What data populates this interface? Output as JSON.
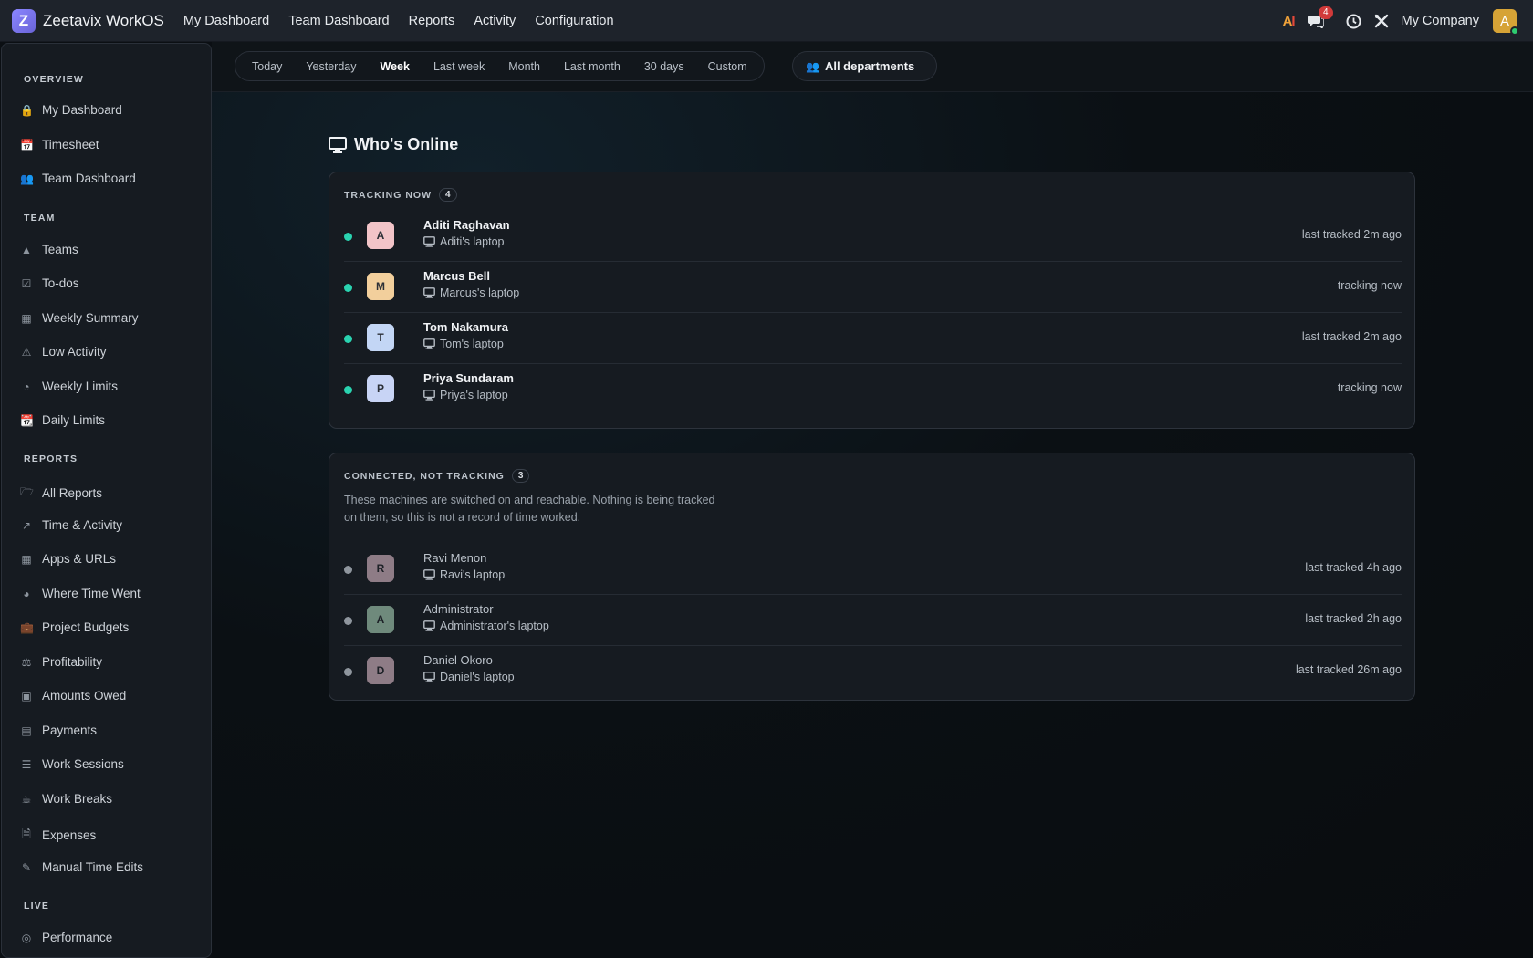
{
  "app": {
    "brand": "Zeetavix WorkOS",
    "brand_letter": "Z",
    "nav": [
      "My Dashboard",
      "Team Dashboard",
      "Reports",
      "Activity",
      "Configuration"
    ],
    "ai_label": "AI",
    "messages_badge": "4",
    "company": "My Company",
    "avatar_letter": "A"
  },
  "sidebar": {
    "overview_label": "OVERVIEW",
    "team_label": "TEAM",
    "reports_label": "REPORTS",
    "live_label": "LIVE",
    "overview": [
      {
        "label": "My Dashboard",
        "icon": "lock-icon"
      },
      {
        "label": "Timesheet",
        "icon": "calendar-icon"
      },
      {
        "label": "Team Dashboard",
        "icon": "users-icon"
      }
    ],
    "team": [
      {
        "label": "Teams",
        "icon": "sitemap-icon"
      },
      {
        "label": "To-dos",
        "icon": "check-square-icon"
      },
      {
        "label": "Weekly Summary",
        "icon": "table-icon"
      },
      {
        "label": "Low Activity",
        "icon": "warning-icon"
      },
      {
        "label": "Weekly Limits",
        "icon": "gauge-icon"
      },
      {
        "label": "Daily Limits",
        "icon": "calendar-check-icon"
      }
    ],
    "reports": [
      {
        "label": "All Reports",
        "icon": "folder-icon"
      },
      {
        "label": "Time & Activity",
        "icon": "line-chart-icon"
      },
      {
        "label": "Apps & URLs",
        "icon": "grid-icon"
      },
      {
        "label": "Where Time Went",
        "icon": "pie-chart-icon"
      },
      {
        "label": "Project Budgets",
        "icon": "briefcase-icon"
      },
      {
        "label": "Profitability",
        "icon": "scale-icon"
      },
      {
        "label": "Amounts Owed",
        "icon": "money-icon"
      },
      {
        "label": "Payments",
        "icon": "credit-card-icon"
      },
      {
        "label": "Work Sessions",
        "icon": "list-icon"
      },
      {
        "label": "Work Breaks",
        "icon": "coffee-icon"
      },
      {
        "label": "Expenses",
        "icon": "receipt-icon"
      },
      {
        "label": "Manual Time Edits",
        "icon": "edit-icon"
      }
    ],
    "live": [
      {
        "label": "Performance",
        "icon": "target-icon"
      }
    ]
  },
  "filters": {
    "periods": [
      "Today",
      "Yesterday",
      "Week",
      "Last week",
      "Month",
      "Last month",
      "30 days",
      "Custom"
    ],
    "active_period": "Week",
    "department": "All departments"
  },
  "page": {
    "title": "Who's Online"
  },
  "tracking": {
    "label": "TRACKING NOW",
    "count": "4",
    "dot_color": "#2ad3b0",
    "rows": [
      {
        "initial": "A",
        "name": "Aditi Raghavan",
        "device": "Aditi's laptop",
        "status": "last tracked 2m ago",
        "avatar_color": "#f2c4c8"
      },
      {
        "initial": "M",
        "name": "Marcus Bell",
        "device": "Marcus's laptop",
        "status": "tracking now",
        "avatar_color": "#f2cf9c"
      },
      {
        "initial": "T",
        "name": "Tom Nakamura",
        "device": "Tom's laptop",
        "status": "last tracked 2m ago",
        "avatar_color": "#c3d6f5"
      },
      {
        "initial": "P",
        "name": "Priya Sundaram",
        "device": "Priya's laptop",
        "status": "tracking now",
        "avatar_color": "#c8d4f5"
      }
    ]
  },
  "connected": {
    "label": "CONNECTED, NOT TRACKING",
    "count": "3",
    "description": "These machines are switched on and reachable. Nothing is being tracked on them, so this is not a record of time worked.",
    "dot_color": "#8f969e",
    "rows": [
      {
        "initial": "R",
        "name": "Ravi Menon",
        "device": "Ravi's laptop",
        "status": "last tracked 4h ago",
        "avatar_color": "#8e7c86"
      },
      {
        "initial": "A",
        "name": "Administrator",
        "device": "Administrator's laptop",
        "status": "last tracked 2h ago",
        "avatar_color": "#6f8a7c"
      },
      {
        "initial": "D",
        "name": "Daniel Okoro",
        "device": "Daniel's laptop",
        "status": "last tracked 26m ago",
        "avatar_color": "#8e7c86"
      }
    ]
  }
}
